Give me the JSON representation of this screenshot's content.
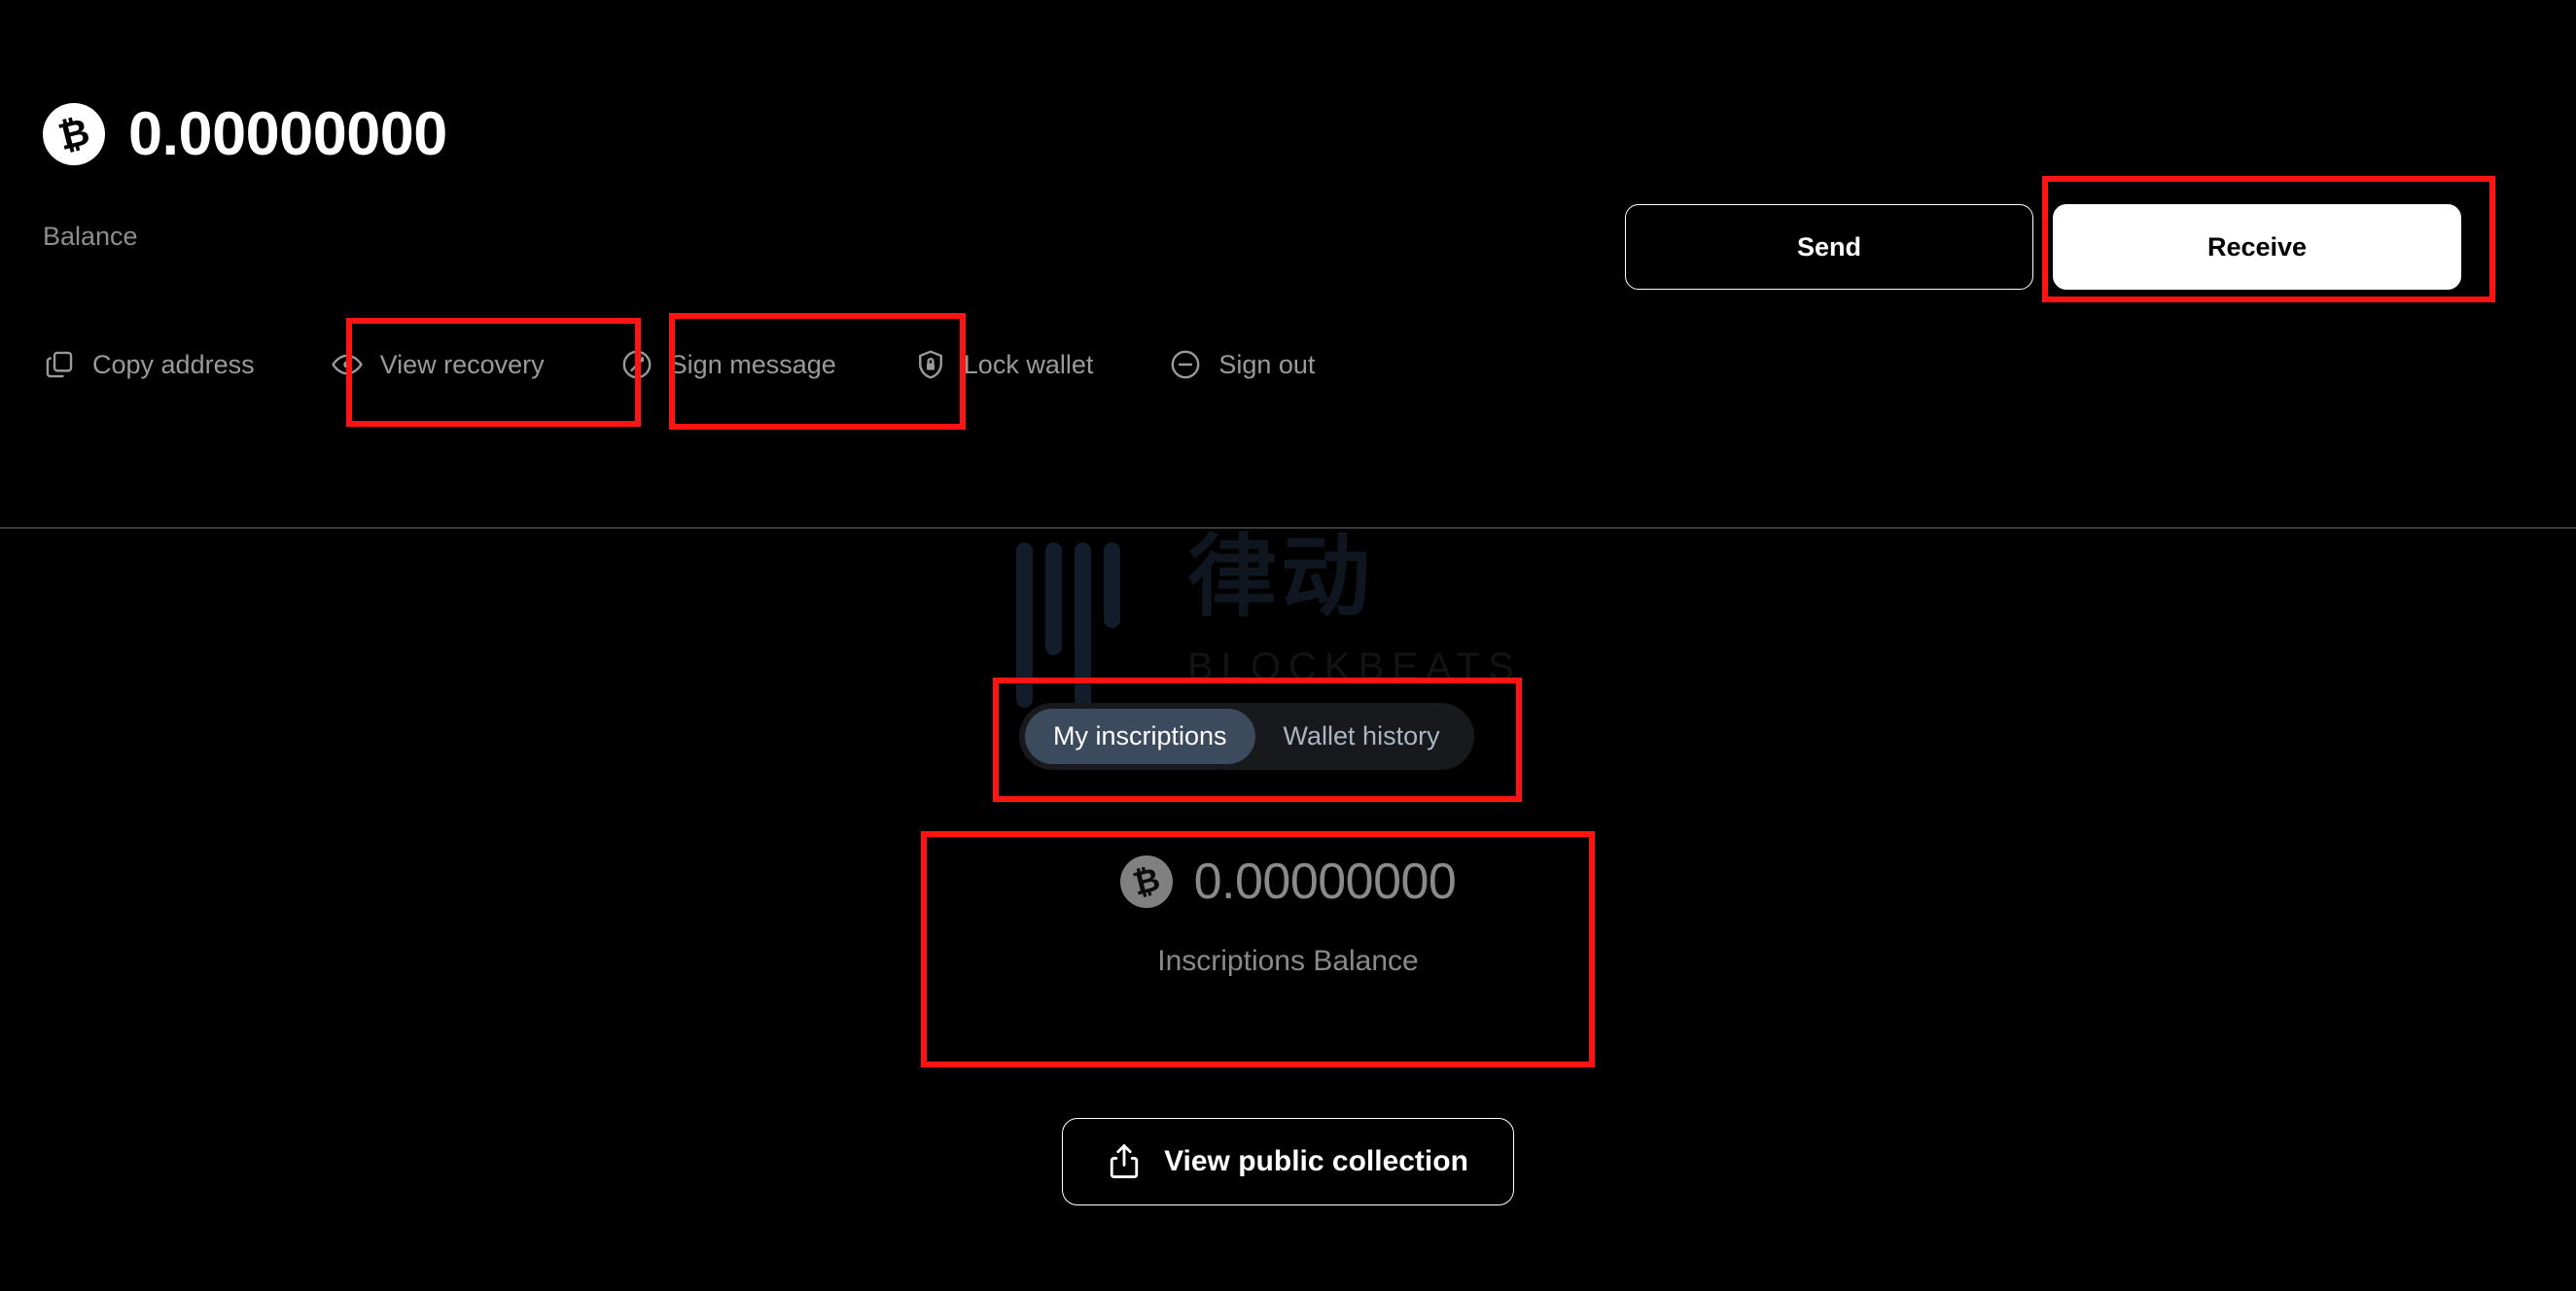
{
  "wallet": {
    "balance_amount": "0.00000000",
    "balance_label": "Balance",
    "btc_symbol": "₿"
  },
  "cta": {
    "send_label": "Send",
    "receive_label": "Receive"
  },
  "actions": [
    {
      "label": "Copy address",
      "icon": "copy-icon"
    },
    {
      "label": "View recovery",
      "icon": "eye-icon"
    },
    {
      "label": "Sign message",
      "icon": "pen-circle-icon"
    },
    {
      "label": "Lock wallet",
      "icon": "shield-lock-icon"
    },
    {
      "label": "Sign out",
      "icon": "minus-circle-icon"
    }
  ],
  "tabs": [
    {
      "label": "My inscriptions",
      "active": true
    },
    {
      "label": "Wallet history",
      "active": false
    }
  ],
  "inscriptions": {
    "amount": "0.00000000",
    "label": "Inscriptions Balance",
    "view_collection_label": "View public collection",
    "share_icon": "share-upload-icon"
  },
  "watermark": {
    "cn_text": "律动",
    "en_text": "BLOCKBEATS"
  },
  "colors": {
    "background": "#000000",
    "text_primary": "#ffffff",
    "text_muted": "#8d8d8d",
    "accent_receive": "#ffffff",
    "tab_active_bg": "#3b4a5c",
    "tab_inactive_text": "#aab6c4",
    "annotation_red": "#ff1414",
    "divider": "#3a3a3a"
  }
}
